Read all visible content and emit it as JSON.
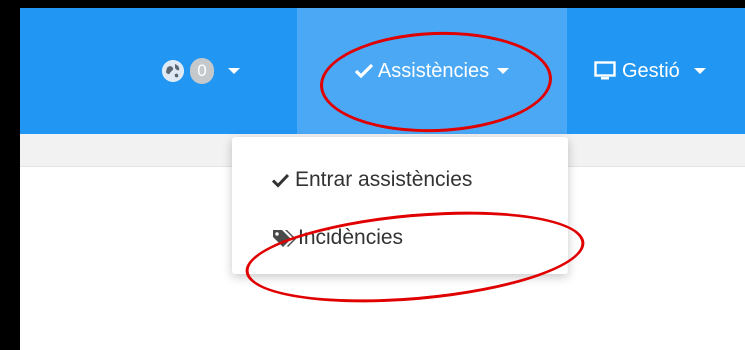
{
  "navbar": {
    "notifications": {
      "count": "0",
      "icon": "globe-icon"
    },
    "assistencies": {
      "label": "Assistències",
      "icon": "check-icon"
    },
    "gestio": {
      "label": "Gestió",
      "icon": "monitor-icon"
    }
  },
  "dropdown": {
    "items": [
      {
        "label": "Entrar assistències",
        "icon": "check-icon"
      },
      {
        "label": "Incidències",
        "icon": "tag-icon"
      }
    ]
  },
  "colors": {
    "navbar": "#2196f3",
    "navbar_active": "#4aa8f5",
    "annotation": "#e00000"
  }
}
